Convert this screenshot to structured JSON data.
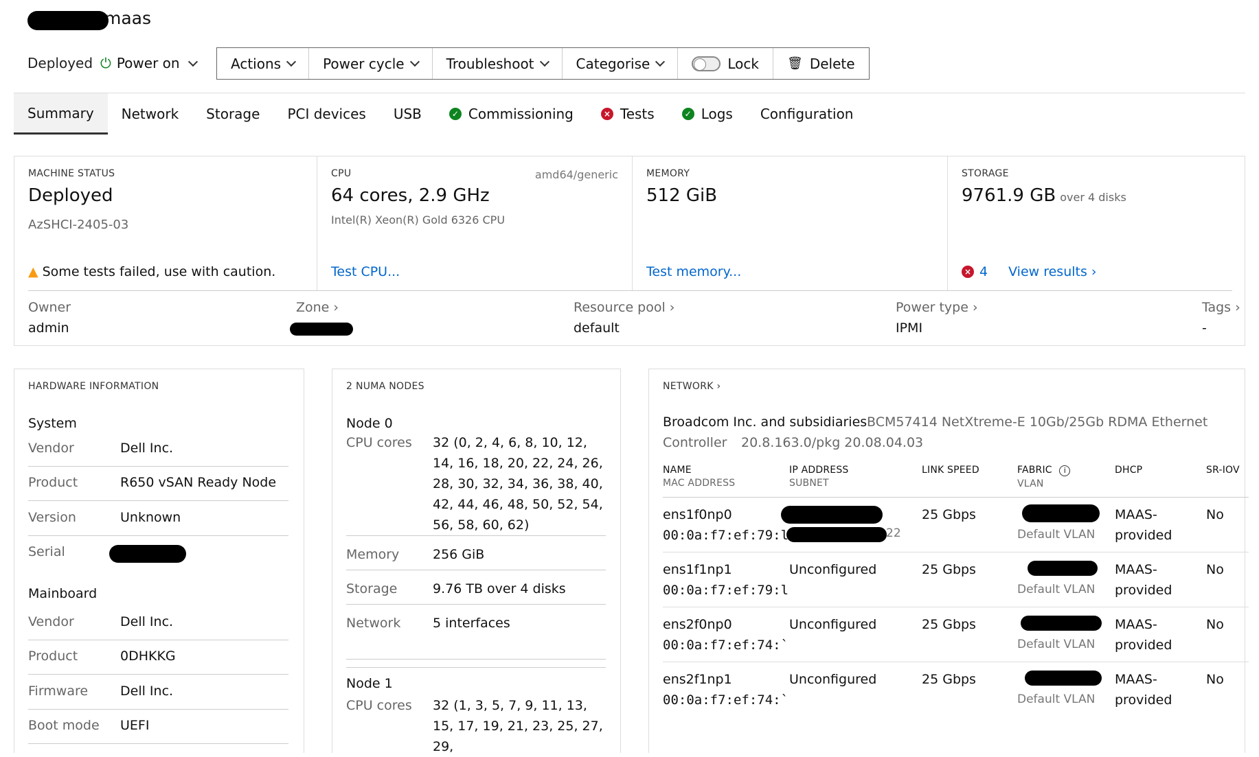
{
  "header": {
    "title_suffix": "maas",
    "status": "Deployed",
    "power_label": "Power on"
  },
  "toolbar": {
    "actions": "Actions",
    "power_cycle": "Power cycle",
    "troubleshoot": "Troubleshoot",
    "categorise": "Categorise",
    "lock": "Lock",
    "delete": "Delete"
  },
  "tabs": [
    "Summary",
    "Network",
    "Storage",
    "PCI devices",
    "USB",
    "Commissioning",
    "Tests",
    "Logs",
    "Configuration"
  ],
  "summary": {
    "machine_status": {
      "label": "MACHINE STATUS",
      "value": "Deployed",
      "sub": "AzSHCI-2405-03",
      "warning": "Some tests failed, use with caution."
    },
    "cpu": {
      "label": "CPU",
      "arch": "amd64/generic",
      "value": "64 cores, 2.9 GHz",
      "sub": "Intel(R) Xeon(R) Gold 6326 CPU",
      "link": "Test CPU..."
    },
    "memory": {
      "label": "MEMORY",
      "value": "512 GiB",
      "link": "Test memory..."
    },
    "storage": {
      "label": "STORAGE",
      "value": "9761.9 GB",
      "sub": "over 4 disks",
      "fail_count": "4",
      "link": "View results ›"
    },
    "owner": {
      "label": "Owner",
      "value": "admin"
    },
    "zone": {
      "label": "Zone ›"
    },
    "resource_pool": {
      "label": "Resource pool ›",
      "value": "default"
    },
    "power_type": {
      "label": "Power type ›",
      "value": "IPMI"
    },
    "tags": {
      "label": "Tags ›",
      "value": "-"
    }
  },
  "hardware": {
    "title": "HARDWARE INFORMATION",
    "system_title": "System",
    "system": [
      {
        "k": "Vendor",
        "v": "Dell Inc."
      },
      {
        "k": "Product",
        "v": "R650 vSAN Ready Node"
      },
      {
        "k": "Version",
        "v": "Unknown"
      },
      {
        "k": "Serial",
        "v": ""
      }
    ],
    "mainboard_title": "Mainboard",
    "mainboard": [
      {
        "k": "Vendor",
        "v": "Dell Inc."
      },
      {
        "k": "Product",
        "v": "0DHKKG"
      },
      {
        "k": "Firmware",
        "v": "Dell Inc."
      },
      {
        "k": "Boot mode",
        "v": "UEFI"
      }
    ]
  },
  "numa": {
    "title": "2 NUMA NODES",
    "node0": {
      "title": "Node 0",
      "cpu_label": "CPU cores",
      "cpu_value": "32 (0, 2, 4, 6, 8, 10, 12, 14, 16, 18, 20, 22, 24, 26, 28, 30, 32, 34, 36, 38, 40, 42, 44, 46, 48, 50, 52, 54, 56, 58, 60, 62)",
      "memory_label": "Memory",
      "memory_value": "256 GiB",
      "storage_label": "Storage",
      "storage_value": "9.76 TB over 4 disks",
      "network_label": "Network",
      "network_value": "5 interfaces"
    },
    "node1": {
      "title": "Node 1",
      "cpu_label": "CPU cores",
      "cpu_value": "32 (1, 3, 5, 7, 9, 11, 13, 15, 17, 19, 21, 23, 25, 27, 29,"
    }
  },
  "network": {
    "title": "NETWORK ›",
    "vendor": "Broadcom Inc. and subsidiaries",
    "product": "BCM57414 NetXtreme-E 10Gb/25Gb RDMA Ethernet",
    "product2": "Controller",
    "firmware": "20.8.163.0/pkg 20.08.04.03",
    "columns": {
      "name": "NAME",
      "mac": "MAC ADDRESS",
      "ip": "IP ADDRESS",
      "subnet": "SUBNET",
      "speed": "LINK SPEED",
      "fabric": "FABRIC",
      "vlan": "VLAN",
      "dhcp": "DHCP",
      "sriov": "SR-IOV"
    },
    "rows": [
      {
        "name": "ens1f0np0",
        "mac": "00:0a:f7:ef:79:l",
        "ip": "",
        "subnet_tail": "22",
        "speed": "25 Gbps",
        "vlan": "Default VLAN",
        "dhcp1": "MAAS-",
        "dhcp2": "provided",
        "sriov": "No"
      },
      {
        "name": "ens1f1np1",
        "mac": "00:0a:f7:ef:79:l",
        "ip": "Unconfigured",
        "subnet_tail": "",
        "speed": "25 Gbps",
        "vlan": "Default VLAN",
        "dhcp1": "MAAS-",
        "dhcp2": "provided",
        "sriov": "No"
      },
      {
        "name": "ens2f0np0",
        "mac": "00:0a:f7:ef:74:`",
        "ip": "Unconfigured",
        "subnet_tail": "",
        "speed": "25 Gbps",
        "vlan": "Default VLAN",
        "dhcp1": "MAAS-",
        "dhcp2": "provided",
        "sriov": "No"
      },
      {
        "name": "ens2f1np1",
        "mac": "00:0a:f7:ef:74:`",
        "ip": "Unconfigured",
        "subnet_tail": "",
        "speed": "25 Gbps",
        "vlan": "Default VLAN",
        "dhcp1": "MAAS-",
        "dhcp2": "provided",
        "sriov": "No"
      }
    ]
  },
  "colors": {
    "link": "#0066cc",
    "success": "#0e8420",
    "error": "#c7162b",
    "warning": "#f99b11"
  }
}
